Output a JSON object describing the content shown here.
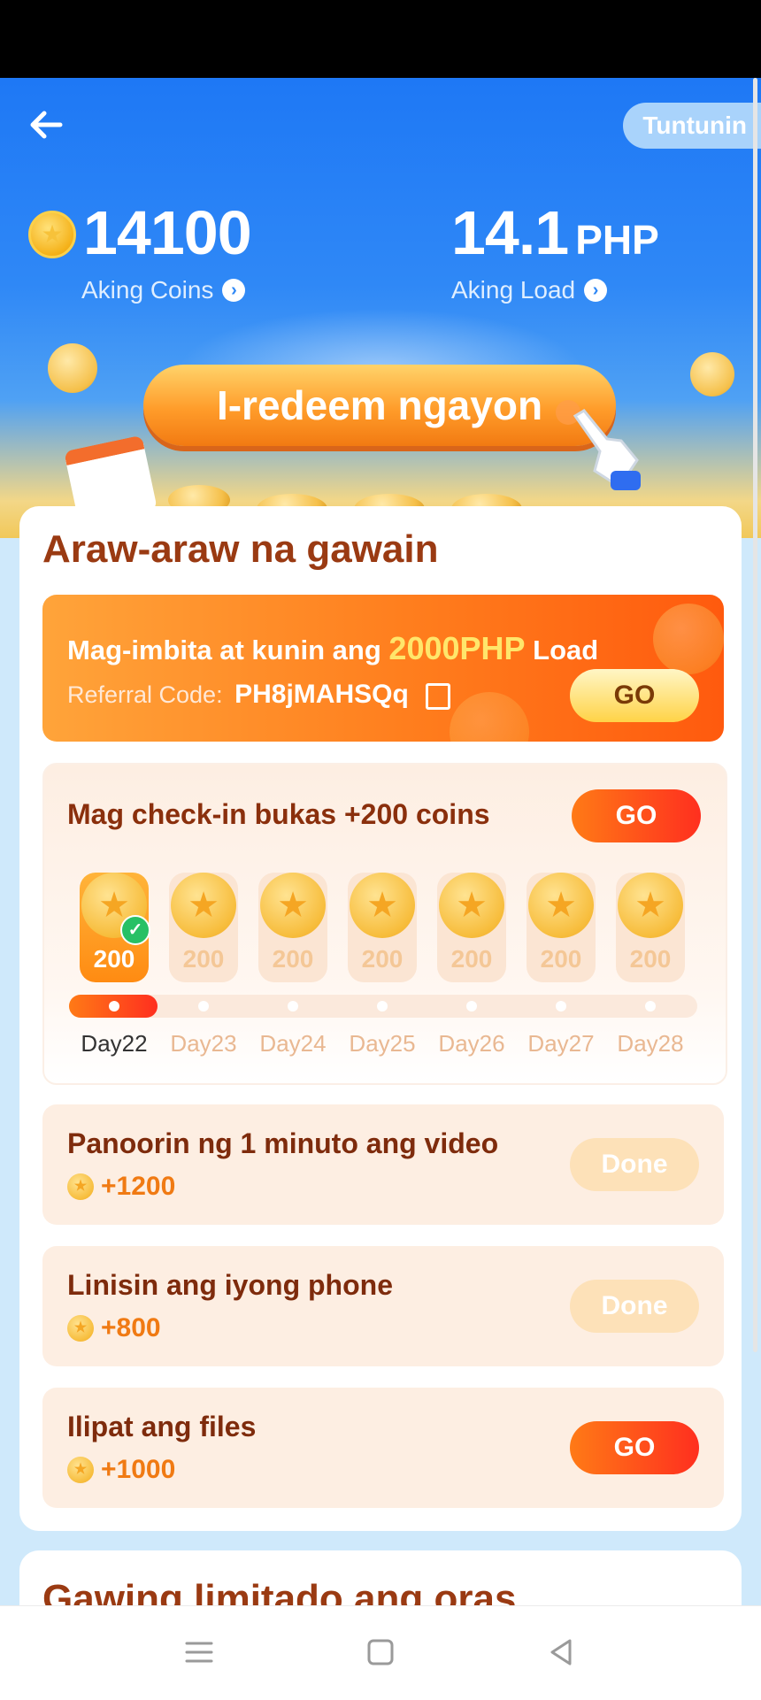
{
  "hero": {
    "rules_label": "Tuntunin",
    "coins_value": "14100",
    "coins_label": "Aking Coins",
    "load_value": "14.1",
    "load_unit": "PHP",
    "load_label": "Aking Load",
    "redeem_label": "I-redeem ngayon"
  },
  "daily": {
    "title": "Araw-araw na gawain",
    "invite": {
      "text_prefix": "Mag-imbita at kunin ang",
      "highlight": "2000PHP",
      "text_suffix": "Load",
      "referral_label": "Referral Code:",
      "referral_code": "PH8jMAHSQq",
      "button": "GO"
    },
    "checkin": {
      "title": "Mag check-in bukas +200 coins",
      "button": "GO",
      "current_day_index": 0,
      "days": [
        {
          "amount": "200",
          "label": "Day22"
        },
        {
          "amount": "200",
          "label": "Day23"
        },
        {
          "amount": "200",
          "label": "Day24"
        },
        {
          "amount": "200",
          "label": "Day25"
        },
        {
          "amount": "200",
          "label": "Day26"
        },
        {
          "amount": "200",
          "label": "Day27"
        },
        {
          "amount": "200",
          "label": "Day28"
        }
      ]
    },
    "tasks": [
      {
        "name": "Panoorin ng 1 minuto ang video",
        "reward": "+1200",
        "button": "Done",
        "done": true
      },
      {
        "name": "Linisin ang iyong phone",
        "reward": "+800",
        "button": "Done",
        "done": true
      },
      {
        "name": "Ilipat ang files",
        "reward": "+1000",
        "button": "GO",
        "done": false
      }
    ]
  },
  "limited": {
    "title": "Gawing limitado ang oras"
  }
}
